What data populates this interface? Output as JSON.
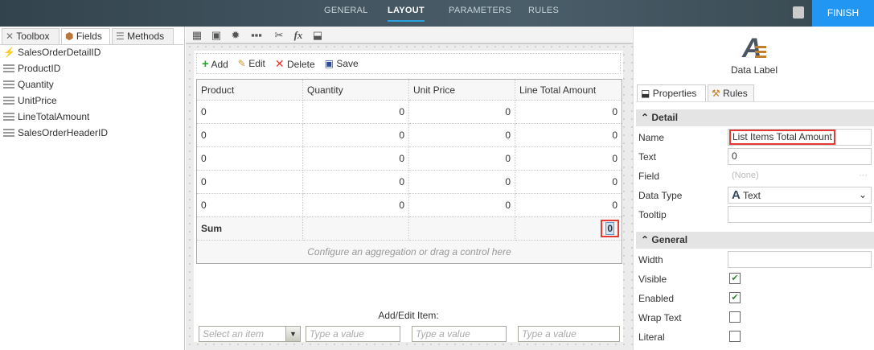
{
  "topbar": {
    "tabs": [
      "GENERAL",
      "LAYOUT",
      "PARAMETERS",
      "RULES"
    ],
    "active": "LAYOUT",
    "finish": "FINISH"
  },
  "left": {
    "tabs": [
      "Toolbox",
      "Fields",
      "Methods"
    ],
    "active": "Fields",
    "fields": [
      "SalesOrderDetailID",
      "ProductID",
      "Quantity",
      "UnitPrice",
      "LineTotalAmount",
      "SalesOrderHeaderID"
    ]
  },
  "list": {
    "toolbar": [
      "Add",
      "Edit",
      "Delete",
      "Save"
    ],
    "columns": [
      "Product",
      "Quantity",
      "Unit Price",
      "Line Total Amount"
    ],
    "rows": [
      [
        "0",
        "0",
        "0",
        "0"
      ],
      [
        "0",
        "0",
        "0",
        "0"
      ],
      [
        "0",
        "0",
        "0",
        "0"
      ],
      [
        "0",
        "0",
        "0",
        "0"
      ],
      [
        "0",
        "0",
        "0",
        "0"
      ]
    ],
    "sum_label": "Sum",
    "sum_value": "0",
    "configure": "Configure an aggregation or drag a control here",
    "add_edit_label": "Add/Edit Item:",
    "select_placeholder": "Select an item",
    "value_placeholder": "Type a value"
  },
  "right": {
    "control_type": "Data Label",
    "tabs": [
      "Properties",
      "Rules"
    ],
    "detail": {
      "title": "Detail",
      "name_label": "Name",
      "name": "List Items Total Amount",
      "text_label": "Text",
      "text": "0",
      "field_label": "Field",
      "field": "(None)",
      "datatype_label": "Data Type",
      "datatype": "Text",
      "tooltip_label": "Tooltip"
    },
    "general": {
      "title": "General",
      "width_label": "Width",
      "visible_label": "Visible",
      "visible": true,
      "enabled_label": "Enabled",
      "enabled": true,
      "wrap_label": "Wrap Text",
      "wrap": false,
      "literal_label": "Literal",
      "literal": false
    }
  },
  "colors": {
    "accent": "#2196f3",
    "highlight": "#e53935"
  }
}
